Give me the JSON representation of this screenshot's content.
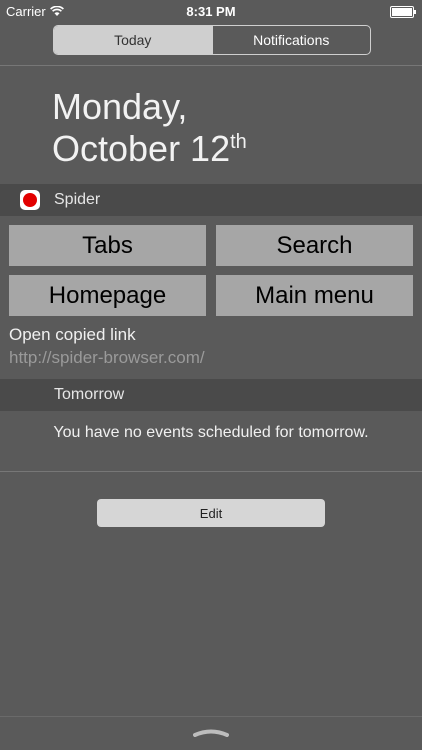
{
  "status": {
    "carrier": "Carrier",
    "time": "8:31 PM"
  },
  "tabs": [
    {
      "label": "Today",
      "active": true
    },
    {
      "label": "Notifications",
      "active": false
    }
  ],
  "date": {
    "line1": "Monday,",
    "line2": "October 12",
    "suffix": "th"
  },
  "widget": {
    "app_name": "Spider",
    "buttons": [
      "Tabs",
      "Search",
      "Homepage",
      "Main menu"
    ],
    "open_link_label": "Open copied link",
    "link_url": "http://spider-browser.com/"
  },
  "tomorrow": {
    "title": "Tomorrow",
    "message": "You have no events scheduled for tomorrow."
  },
  "edit_label": "Edit",
  "colors": {
    "background": "#5a5a5a",
    "section": "#4a4a4a",
    "button": "#a6a6a6",
    "icon_red": "#e20000"
  }
}
